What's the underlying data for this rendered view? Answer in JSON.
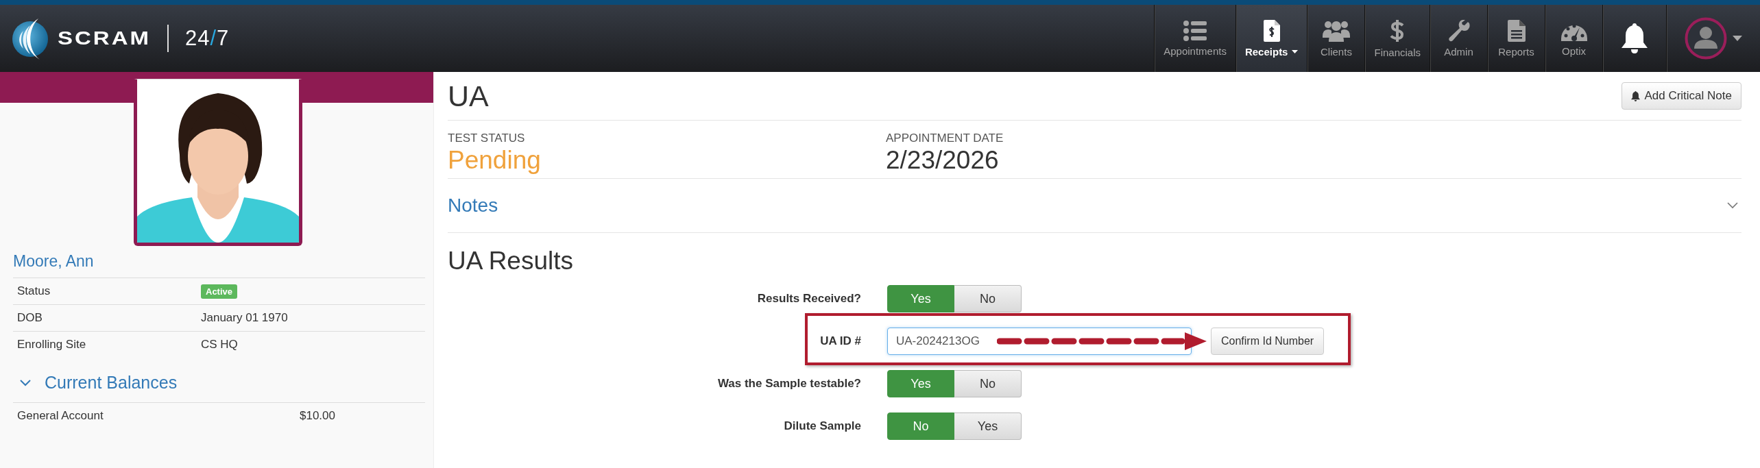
{
  "header": {
    "brand": "SCRAM",
    "product_a": "24",
    "product_sep": "/",
    "product_b": "7"
  },
  "nav": [
    {
      "kind": "list",
      "label": "Appointments",
      "selected": false,
      "dropdown": false
    },
    {
      "kind": "receipt",
      "label": "Receipts",
      "selected": true,
      "dropdown": true
    },
    {
      "kind": "people",
      "label": "Clients",
      "selected": false,
      "dropdown": false
    },
    {
      "kind": "dollar",
      "label": "Financials",
      "selected": false,
      "dropdown": false
    },
    {
      "kind": "wrench",
      "label": "Admin",
      "selected": false,
      "dropdown": false
    },
    {
      "kind": "document",
      "label": "Reports",
      "selected": false,
      "dropdown": false
    },
    {
      "kind": "gauge",
      "label": "Optix",
      "selected": false,
      "dropdown": false
    }
  ],
  "client": {
    "name": "Moore, Ann",
    "details": [
      {
        "kind": "badge",
        "label": "Status",
        "value": "Active"
      },
      {
        "kind": "text",
        "label": "DOB",
        "value": "January 01 1970"
      },
      {
        "kind": "text",
        "label": "Enrolling Site",
        "value": "CS HQ"
      }
    ],
    "balances": {
      "title": "Current Balances",
      "expanded": true,
      "rows": [
        {
          "label": "General Account",
          "value": "$10.00"
        }
      ]
    }
  },
  "main": {
    "title": "UA",
    "critical_note_button": "Add Critical Note",
    "summary": [
      {
        "kind": "status",
        "label": "TEST STATUS",
        "value": "Pending"
      },
      {
        "kind": "plain",
        "label": "APPOINTMENT DATE",
        "value": "2/23/2026"
      }
    ],
    "notes": {
      "title": "Notes",
      "expanded": false
    },
    "results": {
      "title": "UA Results",
      "fields": [
        {
          "kind": "toggle",
          "label": "Results Received?",
          "options": [
            {
              "label": "Yes",
              "selected": true
            },
            {
              "label": "No",
              "selected": false
            }
          ]
        },
        {
          "kind": "text",
          "label": "UA ID #",
          "value": "UA-2024213OG",
          "highlighted": true,
          "button": "Confirm Id Number"
        },
        {
          "kind": "toggle",
          "label": "Was the Sample testable?",
          "options": [
            {
              "label": "Yes",
              "selected": true
            },
            {
              "label": "No",
              "selected": false
            }
          ]
        },
        {
          "kind": "toggle",
          "label": "Dilute Sample",
          "options": [
            {
              "label": "No",
              "selected": true
            },
            {
              "label": "Yes",
              "selected": false
            }
          ]
        }
      ]
    }
  }
}
